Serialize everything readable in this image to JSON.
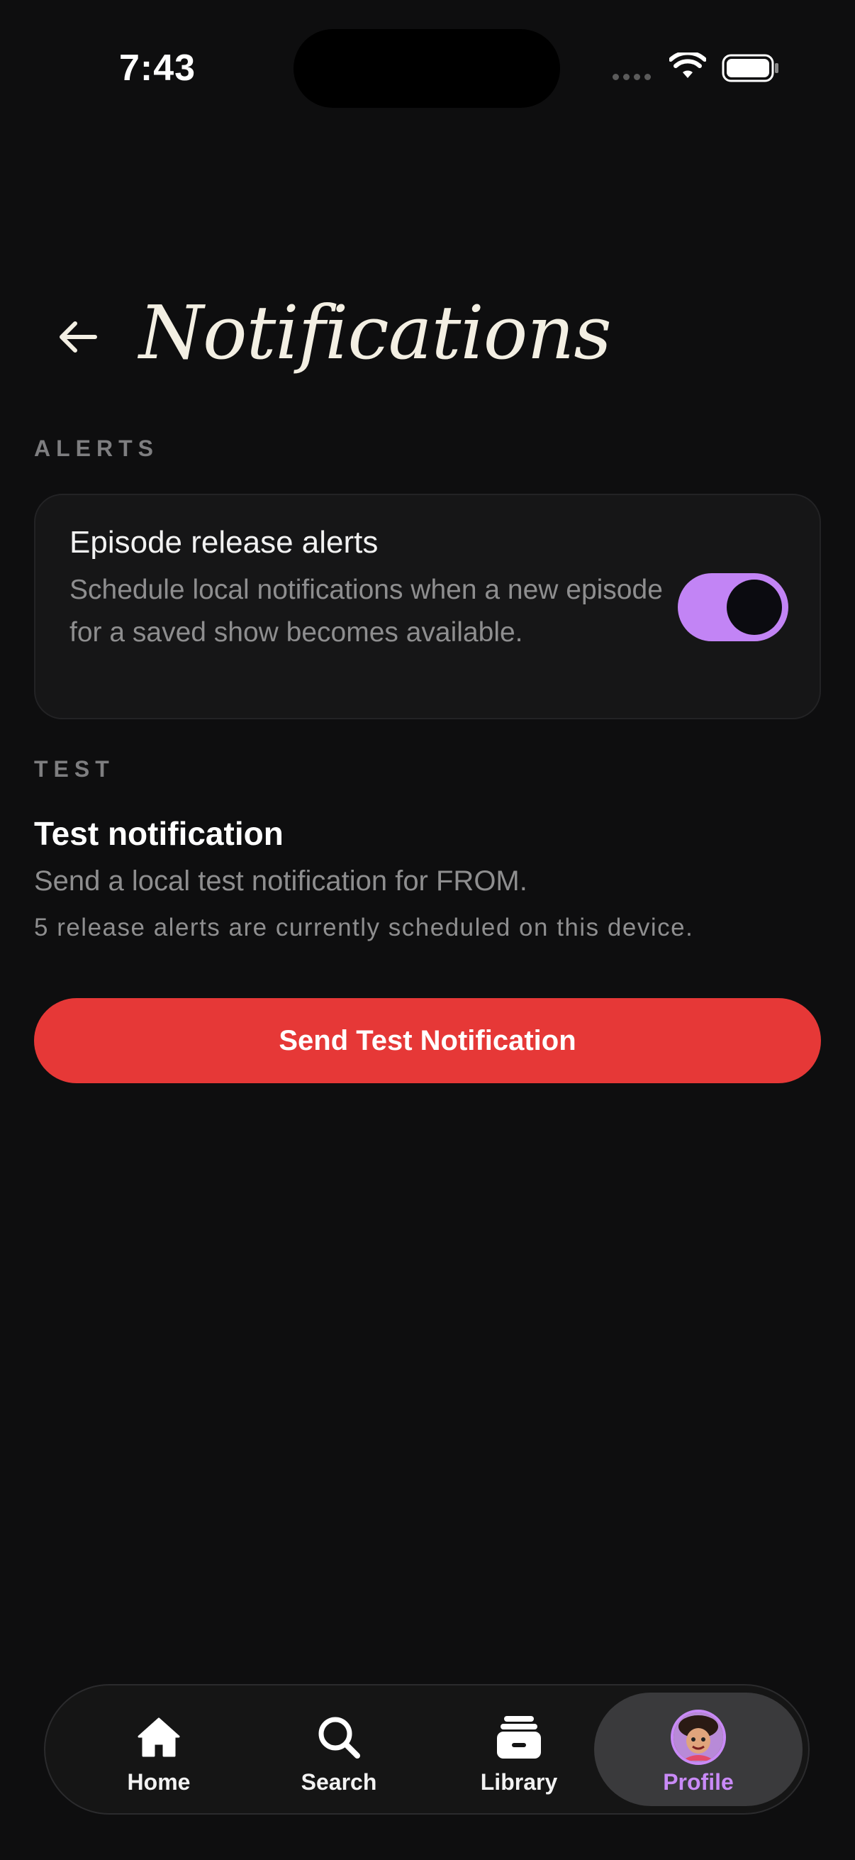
{
  "status_bar": {
    "time": "7:43",
    "icons": [
      "cellular-dots-icon",
      "wifi-icon",
      "battery-icon"
    ]
  },
  "header": {
    "back_icon": "arrow-left-icon",
    "title": "Notifications"
  },
  "alerts_section": {
    "label": "ALERTS",
    "card": {
      "title": "Episode release alerts",
      "description": "Schedule local notifications when a new episode for a saved show becomes available.",
      "toggle_on": true
    }
  },
  "test_section": {
    "label": "TEST",
    "title": "Test notification",
    "description": "Send a local test notification for FROM.",
    "count_text": "5 release alerts are currently scheduled on this device.",
    "button_label": "Send Test Notification"
  },
  "tab_bar": {
    "items": [
      {
        "label": "Home",
        "icon": "home-icon"
      },
      {
        "label": "Search",
        "icon": "search-icon"
      },
      {
        "label": "Library",
        "icon": "library-icon"
      },
      {
        "label": "Profile",
        "icon": "avatar",
        "active": true
      }
    ]
  },
  "colors": {
    "background": "#0e0e0f",
    "accent": "#c284f5",
    "button": "#e63837",
    "muted_text": "#8e8e8f"
  }
}
